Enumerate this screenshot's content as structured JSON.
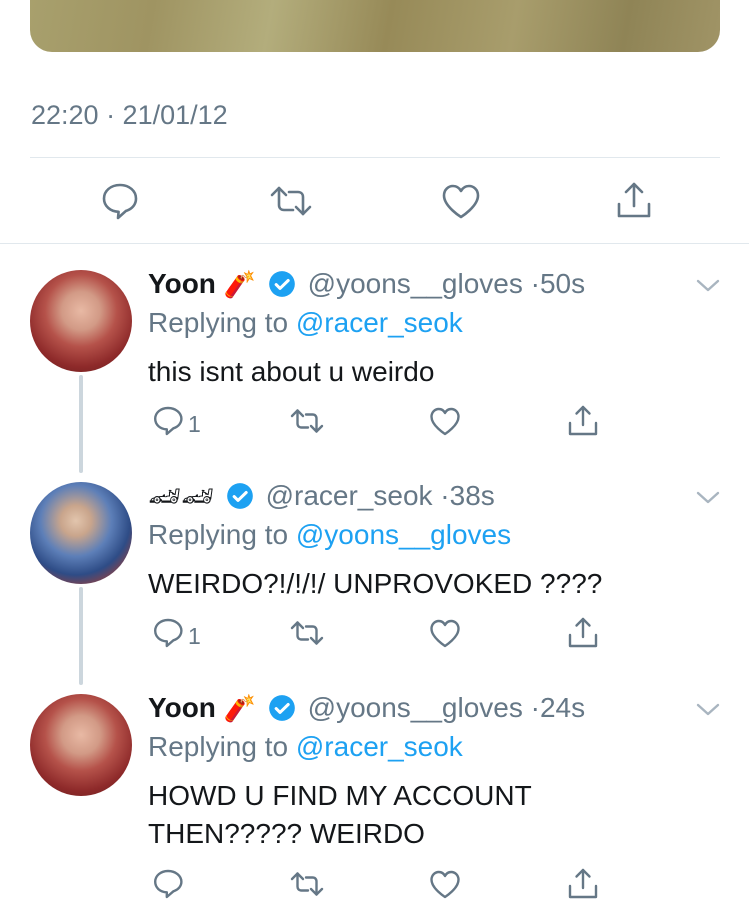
{
  "main_tweet": {
    "timestamp": "22:20 · 21/01/12",
    "actions": [
      "reply-icon",
      "retweet-icon",
      "like-icon",
      "share-icon"
    ]
  },
  "replies": [
    {
      "name": "Yoon",
      "emoji": "🧨",
      "handle": "@yoons__gloves",
      "separator": "·",
      "time": "50s",
      "replying_prefix": "Replying to ",
      "replying_to": "@racer_seok",
      "text": "this isnt about u weirdo",
      "reply_count": "1"
    },
    {
      "name": "",
      "emoji": "🏎🏎",
      "handle": "@racer_seok",
      "separator": "·",
      "time": "38s",
      "replying_prefix": "Replying to ",
      "replying_to": "@yoons__gloves",
      "text": "WEIRDO?!/!/!/ UNPROVOKED ????",
      "reply_count": "1"
    },
    {
      "name": "Yoon",
      "emoji": "🧨",
      "handle": "@yoons__gloves",
      "separator": "·",
      "time": "24s",
      "replying_prefix": "Replying to ",
      "replying_to": "@racer_seok",
      "text_line1": "HOWD U FIND MY ACCOUNT",
      "text_line2": "THEN????? WEIRDO",
      "reply_count": ""
    }
  ],
  "colors": {
    "link": "#1da1f2",
    "secondary": "#657786",
    "icon": "#657786",
    "divider": "#e1e8ed",
    "verified": "#1da1f2"
  }
}
